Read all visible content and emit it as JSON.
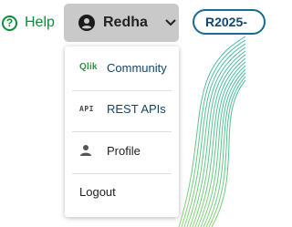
{
  "header": {
    "help_label": "Help",
    "user_name": "Redha",
    "release_label": "R2025-"
  },
  "menu": {
    "items": [
      {
        "label": "Community",
        "icon": "qlik-logo-icon",
        "icon_text": "Qlik"
      },
      {
        "label": "REST APIs",
        "icon": "api-icon",
        "icon_text": "API"
      },
      {
        "label": "Profile",
        "icon": "person-icon"
      },
      {
        "label": "Logout"
      }
    ]
  },
  "colors": {
    "help_green": "#0f8b3a",
    "link_blue": "#14466a",
    "menu_text": "#222222",
    "user_button_bg": "#c9c9c9",
    "pill_border": "#1a6b8c"
  }
}
